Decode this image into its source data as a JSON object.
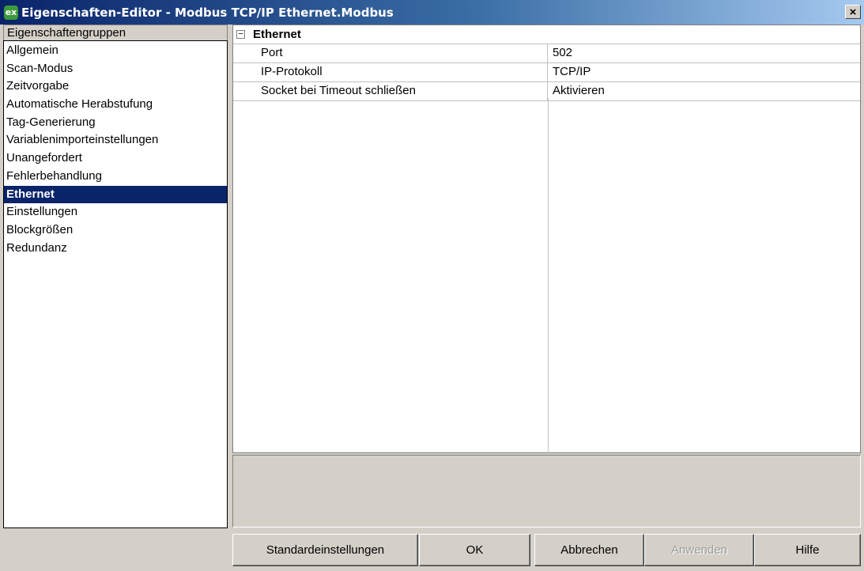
{
  "window": {
    "icon_text": "ex",
    "title": "Eigenschaften-Editor - Modbus TCP/IP Ethernet.Modbus",
    "close_label": "×"
  },
  "left_panel": {
    "header": "Eigenschaftengruppen",
    "items": [
      {
        "label": "Allgemein",
        "selected": false
      },
      {
        "label": "Scan-Modus",
        "selected": false
      },
      {
        "label": "Zeitvorgabe",
        "selected": false
      },
      {
        "label": "Automatische Herabstufung",
        "selected": false
      },
      {
        "label": "Tag-Generierung",
        "selected": false
      },
      {
        "label": "Variablenimporteinstellungen",
        "selected": false
      },
      {
        "label": "Unangefordert",
        "selected": false
      },
      {
        "label": "Fehlerbehandlung",
        "selected": false
      },
      {
        "label": "Ethernet",
        "selected": true
      },
      {
        "label": "Einstellungen",
        "selected": false
      },
      {
        "label": "Blockgrößen",
        "selected": false
      },
      {
        "label": "Redundanz",
        "selected": false
      }
    ]
  },
  "property_grid": {
    "group_title": "Ethernet",
    "expander_symbol": "−",
    "rows": [
      {
        "name": "Port",
        "value": "502"
      },
      {
        "name": "IP-Protokoll",
        "value": "TCP/IP"
      },
      {
        "name": "Socket bei Timeout schließen",
        "value": "Aktivieren"
      }
    ]
  },
  "description": "",
  "buttons": {
    "defaults": "Standardeinstellungen",
    "ok": "OK",
    "cancel": "Abbrechen",
    "apply": "Anwenden",
    "help": "Hilfe"
  },
  "colors": {
    "selection": "#0a246a",
    "window_bg": "#d4d0c8"
  }
}
